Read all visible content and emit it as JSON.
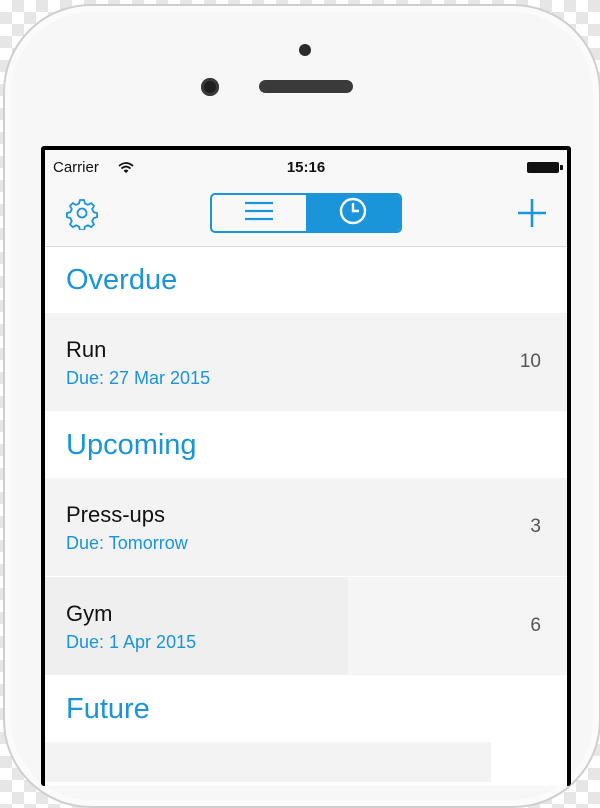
{
  "statusbar": {
    "carrier": "Carrier",
    "time": "15:16"
  },
  "navbar": {
    "icons": {
      "left": "gear-icon",
      "seg_list": "list-icon",
      "seg_clock": "clock-icon",
      "right": "plus-icon"
    },
    "active_segment": "clock"
  },
  "colors": {
    "accent": "#1a95d9",
    "row_bg": "#f3f3f3",
    "text": "#111111"
  },
  "sections": [
    {
      "title": "Overdue",
      "items": [
        {
          "title": "Run",
          "due": "Due: 27 Mar 2015",
          "count": "10"
        }
      ]
    },
    {
      "title": "Upcoming",
      "items": [
        {
          "title": "Press-ups",
          "due": "Due: Tomorrow",
          "count": "3"
        },
        {
          "title": "Gym",
          "due": "Due: 1 Apr 2015",
          "count": "6"
        }
      ]
    },
    {
      "title": "Future",
      "items": []
    }
  ]
}
